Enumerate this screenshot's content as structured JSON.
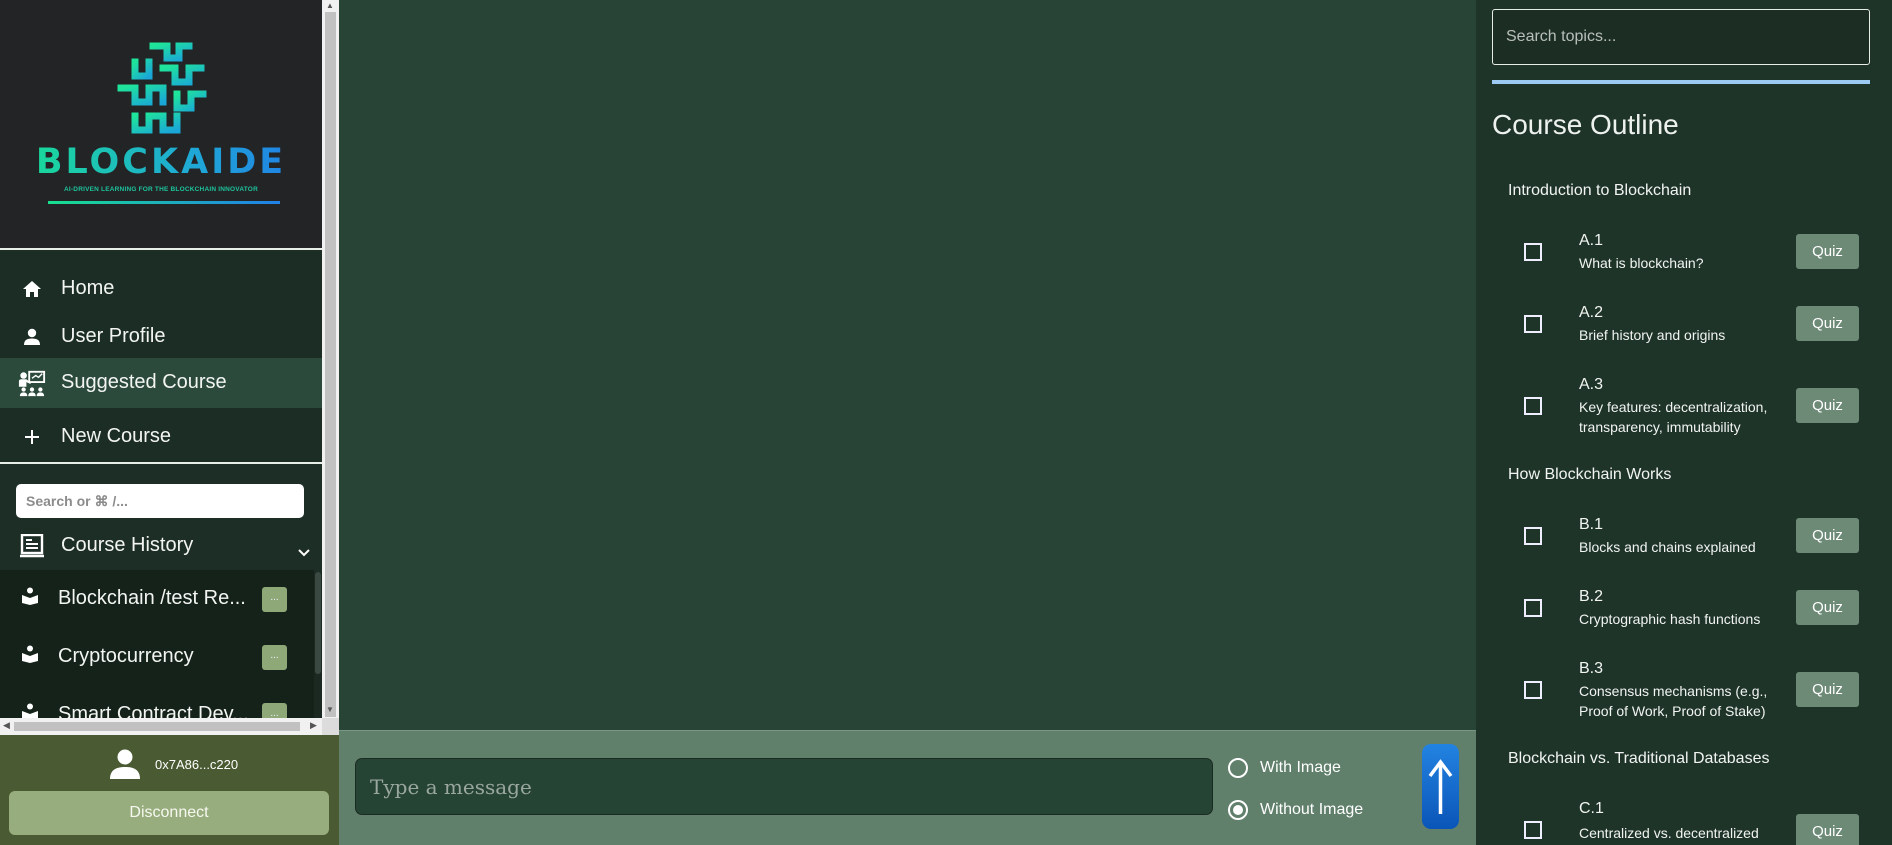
{
  "sidebar": {
    "brand": {
      "name": "BLOCKAIDE",
      "tagline": "AI-DRIVEN LEARNING FOR THE BLOCKCHAIN INNOVATOR"
    },
    "nav": [
      {
        "label": "Home",
        "icon": "home-icon"
      },
      {
        "label": "User Profile",
        "icon": "user-icon"
      },
      {
        "label": "Suggested Course",
        "icon": "teacher-icon",
        "active": true
      },
      {
        "label": "New Course",
        "icon": "plus-icon"
      }
    ],
    "search_placeholder": "Search or ⌘ /...",
    "history_label": "Course History",
    "history": [
      {
        "label": "Blockchain /test Re...",
        "more": "..."
      },
      {
        "label": "Cryptocurrency",
        "more": "..."
      },
      {
        "label": "Smart Contract Dev...",
        "more": "..."
      }
    ],
    "wallet": "0x7A86...c220",
    "disconnect": "Disconnect"
  },
  "composer": {
    "placeholder": "Type a message",
    "options": [
      "With Image",
      "Without Image"
    ],
    "selected": "Without Image"
  },
  "outline": {
    "search_placeholder": "Search topics...",
    "title": "Course Outline",
    "quiz_label": "Quiz",
    "sections": [
      {
        "title": "Introduction to Blockchain",
        "lessons": [
          {
            "code": "A.1",
            "desc": "What is blockchain?"
          },
          {
            "code": "A.2",
            "desc": "Brief history and origins"
          },
          {
            "code": "A.3",
            "desc": "Key features: decentralization, transparency, immutability"
          }
        ]
      },
      {
        "title": "How Blockchain Works",
        "lessons": [
          {
            "code": "B.1",
            "desc": "Blocks and chains explained"
          },
          {
            "code": "B.2",
            "desc": "Cryptographic hash functions"
          },
          {
            "code": "B.3",
            "desc": "Consensus mechanisms (e.g., Proof of Work, Proof of Stake)"
          }
        ]
      },
      {
        "title": "Blockchain vs. Traditional Databases",
        "lessons": [
          {
            "code": "C.1",
            "desc": "Centralized vs. decentralized"
          }
        ]
      }
    ]
  },
  "colors": {
    "main_bg": "#274436",
    "sidebar_bg": "#1d2e26",
    "accent_green": "#98ad7d",
    "send_blue": "#1a6fd3"
  }
}
